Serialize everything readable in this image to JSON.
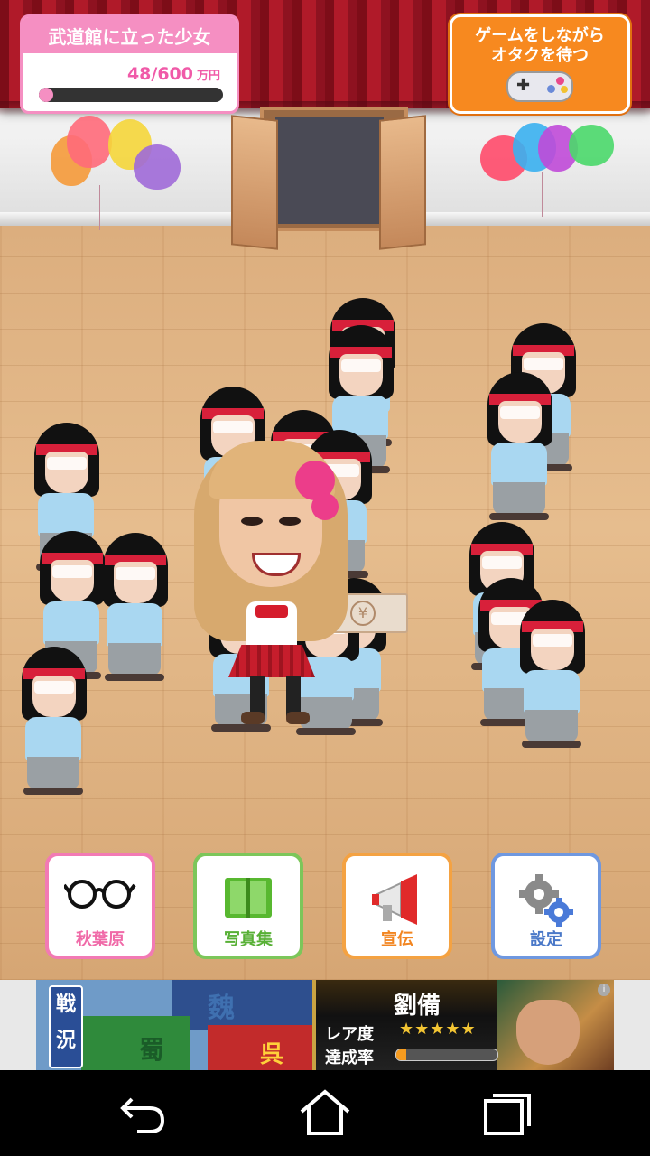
{
  "title_panel": {
    "title": "武道館に立った少女",
    "money": "48/600",
    "unit": "万円",
    "progress": 0.08,
    "accent_color": "#f58fc2"
  },
  "game_button": {
    "line1": "ゲームをしながら",
    "line2": "オタクを待つ",
    "icon": "gamepad-icon",
    "color": "#f7891f"
  },
  "yen_note": {
    "symbol": "¥"
  },
  "menu": [
    {
      "label": "秋葉原",
      "icon": "glasses-icon",
      "color": "#f27ab4"
    },
    {
      "label": "写真集",
      "icon": "photobook-icon",
      "color": "#7cc65a"
    },
    {
      "label": "宣伝",
      "icon": "megaphone-icon",
      "color": "#f4a242"
    },
    {
      "label": "設定",
      "icon": "gears-icon",
      "color": "#6f98e0"
    }
  ],
  "banner": {
    "tag": "戦況",
    "region_wei": "魏",
    "region_shu": "蜀",
    "region_wu": "呉",
    "name": "劉備",
    "rarity_label": "レア度",
    "stars": "★★★★★",
    "rate_label": "達成率",
    "rate": 0.1,
    "info_icon": "i"
  },
  "navbar": {
    "back_icon": "back-arrow-icon",
    "home_icon": "home-icon",
    "recent_icon": "recent-apps-icon"
  }
}
